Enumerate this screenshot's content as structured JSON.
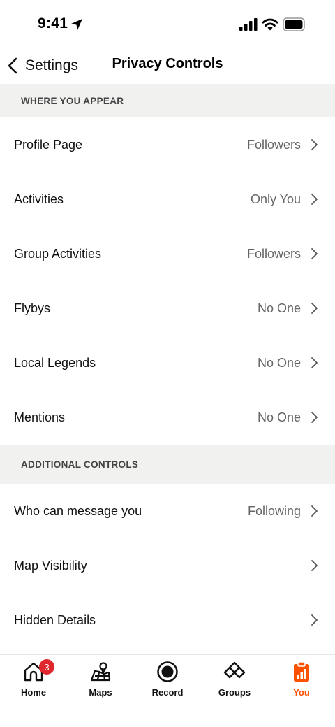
{
  "status_bar": {
    "time": "9:41"
  },
  "nav": {
    "back_label": "Settings",
    "title": "Privacy Controls"
  },
  "sections": [
    {
      "header": "WHERE YOU APPEAR",
      "rows": [
        {
          "label": "Profile Page",
          "value": "Followers"
        },
        {
          "label": "Activities",
          "value": "Only You"
        },
        {
          "label": "Group Activities",
          "value": "Followers"
        },
        {
          "label": "Flybys",
          "value": "No One"
        },
        {
          "label": "Local Legends",
          "value": "No One"
        },
        {
          "label": "Mentions",
          "value": "No One"
        }
      ]
    },
    {
      "header": "ADDITIONAL CONTROLS",
      "rows": [
        {
          "label": "Who can message you",
          "value": "Following"
        },
        {
          "label": "Map Visibility",
          "value": ""
        },
        {
          "label": "Hidden Details",
          "value": ""
        }
      ]
    }
  ],
  "tab_bar": {
    "active": "You",
    "accent_color": "#fc5200",
    "tabs": [
      {
        "label": "Home",
        "icon": "home-icon",
        "badge": "3"
      },
      {
        "label": "Maps",
        "icon": "map-icon"
      },
      {
        "label": "Record",
        "icon": "record-icon"
      },
      {
        "label": "Groups",
        "icon": "groups-icon"
      },
      {
        "label": "You",
        "icon": "clipboard-chart-icon"
      }
    ]
  }
}
